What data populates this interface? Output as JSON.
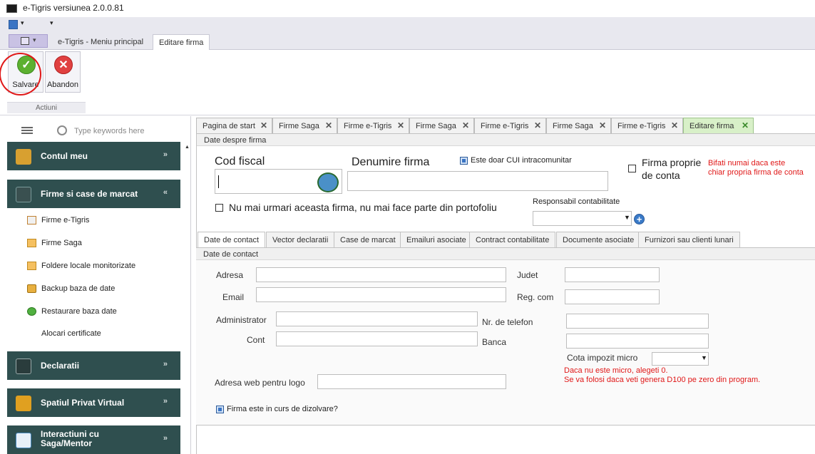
{
  "window": {
    "title": "e-Tigris versiunea 2.0.0.81"
  },
  "ribbon": {
    "tabs": [
      "e-Tigris  - Meniu principal",
      "Editare firma"
    ],
    "buttons": {
      "save": "Salvare",
      "cancel": "Abandon"
    },
    "group_label": "Actiuni"
  },
  "sidebar": {
    "search_placeholder": "Type keywords here",
    "sections": [
      {
        "label": "Contul meu",
        "chevron": "»"
      },
      {
        "label": "Firme si case de marcat",
        "chevron": "«"
      },
      {
        "label": "Declaratii",
        "chevron": "»"
      },
      {
        "label": "Spatiul Privat Virtual",
        "chevron": "»"
      },
      {
        "label": "Interactiuni cu Saga/Mentor",
        "chevron": "»"
      }
    ],
    "items": [
      "Firme e-Tigris",
      "Firme Saga",
      "Foldere locale monitorizate",
      "Backup baza de date",
      "Restaurare baza date",
      "Alocari certificate"
    ]
  },
  "doc_tabs": [
    "Pagina de start",
    "Firme Saga",
    "Firme e-Tigris",
    "Firme Saga",
    "Firme e-Tigris",
    "Firme Saga",
    "Firme e-Tigris",
    "Editare firma"
  ],
  "form": {
    "section_title": "Date despre firma",
    "cod_fiscal_label": "Cod fiscal",
    "cod_fiscal_value": "",
    "denumire_label": "Denumire firma",
    "denumire_value": "",
    "cui_intracom_label": "Este doar CUI intracomunitar",
    "firma_proprie_label_1": "Firma proprie",
    "firma_proprie_label_2": "de conta",
    "firma_proprie_hint_1": "Bifati numai daca este",
    "firma_proprie_hint_2": "chiar propria firma de conta",
    "nu_urmari_label": "Nu mai urmari aceasta firma, nu mai face parte din portofoliu",
    "responsabil_label": "Responsabil contabilitate",
    "responsabil_value": ""
  },
  "inner_tabs": [
    "Date de contact",
    "Vector declaratii",
    "Case de marcat",
    "Emailuri asociate",
    "Contract contabilitate",
    "Documente asociate",
    "Furnizori sau clienti lunari"
  ],
  "contact": {
    "section_title": "Date de contact",
    "adresa": "Adresa",
    "email": "Email",
    "administrator": "Administrator",
    "cont": "Cont",
    "judet": "Judet",
    "reg_com": "Reg. com",
    "telefon": "Nr. de telefon",
    "banca": "Banca",
    "cota_micro": "Cota impozit micro",
    "cota_hint_1": "Daca nu este micro, alegeti 0.",
    "cota_hint_2": "Se va folosi daca veti genera  D100 pe zero din program.",
    "adresa_web": "Adresa web pentru logo",
    "dizolvare": "Firma este in curs de dizolvare?"
  }
}
